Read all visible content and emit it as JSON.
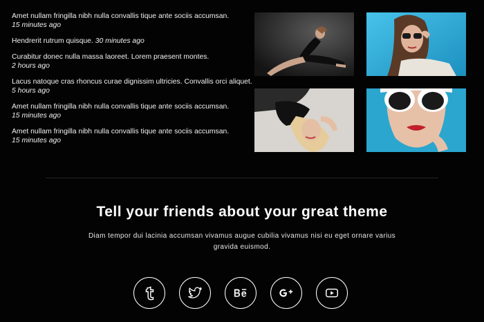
{
  "tweets": [
    {
      "text": "Amet nullam fringilla nibh nulla convallis tique ante sociis accumsan.",
      "time": "15 minutes ago"
    },
    {
      "text": "Hendrerit rutrum quisque.",
      "time": "30 minutes ago"
    },
    {
      "text": "Curabitur donec nulla massa laoreet. Lorem praesent montes.",
      "time": "2 hours ago"
    },
    {
      "text": "Lacus natoque cras rhoncus curae dignissim ultricies. Convallis orci aliquet.",
      "time": "5 hours ago"
    },
    {
      "text": "Amet nullam fringilla nibh nulla convallis tique ante sociis accumsan.",
      "time": "15 minutes ago"
    },
    {
      "text": "Amet nullam fringilla nibh nulla convallis tique ante sociis accumsan.",
      "time": "15 minutes ago"
    }
  ],
  "gallery": {
    "images": [
      {
        "icon": "photo-model-stretching"
      },
      {
        "icon": "photo-woman-sunglasses-blue"
      },
      {
        "icon": "photo-woman-lying-blonde"
      },
      {
        "icon": "photo-woman-white-sunglasses"
      }
    ]
  },
  "cta": {
    "title": "Tell your friends about your great theme",
    "description": "Diam tempor dui lacinia accumsan vivamus augue cubilia vivamus nisi eu eget ornare varius gravida euismod."
  },
  "social": [
    {
      "icon": "tumblr-icon"
    },
    {
      "icon": "twitter-icon"
    },
    {
      "icon": "behance-icon"
    },
    {
      "icon": "google-plus-icon"
    },
    {
      "icon": "youtube-icon"
    }
  ],
  "colors": {
    "background": "#030303",
    "text": "#f2f2f2",
    "divider": "#262626",
    "photo_blue": "#2aa6cf"
  }
}
